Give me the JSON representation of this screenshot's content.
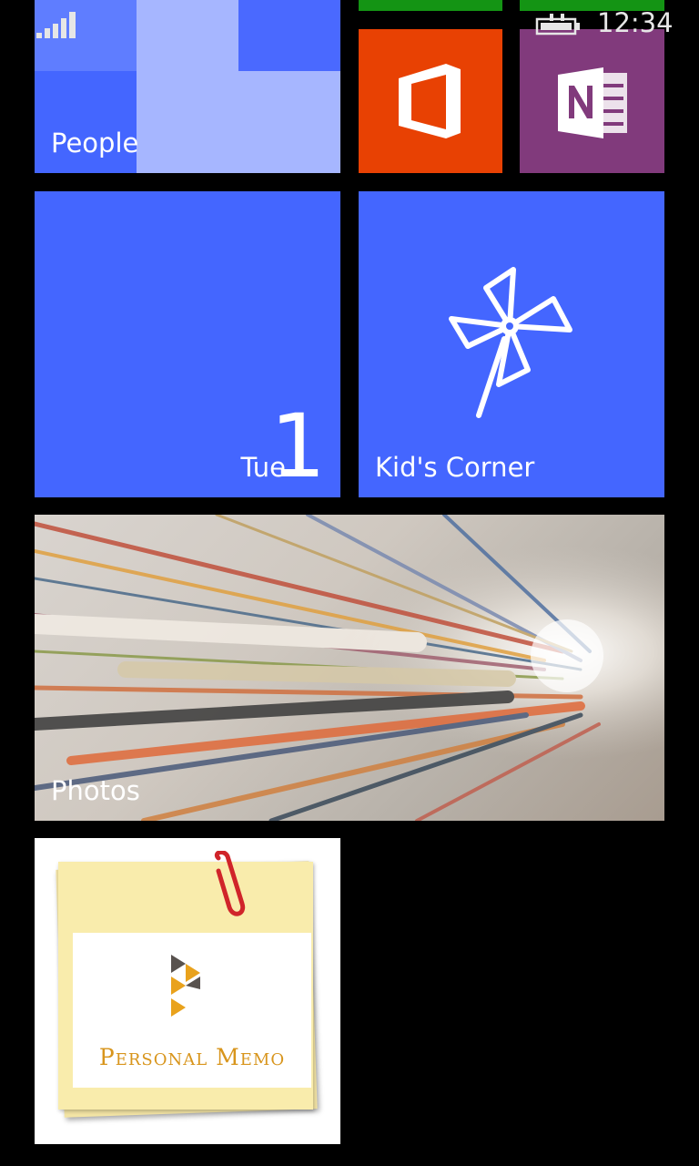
{
  "status_bar": {
    "time": "12:34"
  },
  "tiles": {
    "people": {
      "label": "People"
    },
    "office": {
      "label": ""
    },
    "onenote": {
      "label": ""
    },
    "calendar": {
      "day": "Tue",
      "date": "1"
    },
    "kids_corner": {
      "label": "Kid's Corner"
    },
    "photos": {
      "label": "Photos"
    },
    "personal_memo": {
      "title": "Personal Memo"
    }
  },
  "colors": {
    "accent_blue": "#4466ff",
    "office_orange": "#e84103",
    "onenote_purple": "#813a7c",
    "top_green": "#149414",
    "memo_gold": "#d8951c"
  }
}
